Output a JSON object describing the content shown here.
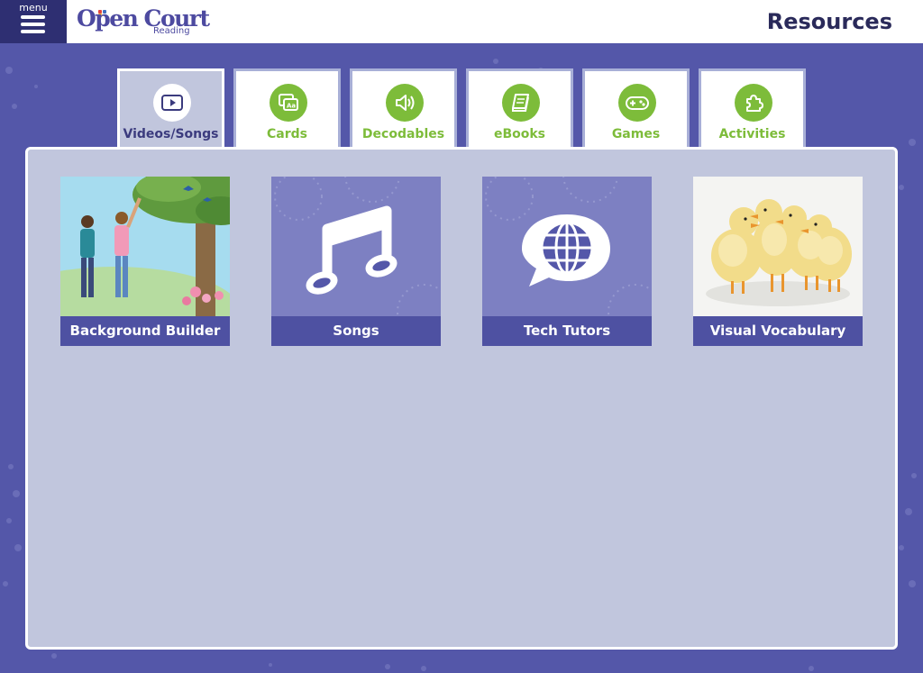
{
  "header": {
    "menu_label": "menu",
    "logo": {
      "text": "Open Court",
      "sub": "Reading"
    },
    "title": "Resources"
  },
  "tabs": [
    {
      "label": "Videos/Songs",
      "icon": "video-play-icon",
      "active": true
    },
    {
      "label": "Cards",
      "icon": "cards-icon",
      "active": false
    },
    {
      "label": "Decodables",
      "icon": "speaker-icon",
      "active": false
    },
    {
      "label": "eBooks",
      "icon": "book-icon",
      "active": false
    },
    {
      "label": "Games",
      "icon": "gamepad-icon",
      "active": false
    },
    {
      "label": "Activities",
      "icon": "puzzle-icon",
      "active": false
    }
  ],
  "cards": [
    {
      "label": "Background Builder",
      "image": "children-under-tree-image"
    },
    {
      "label": "Songs",
      "image": "music-note-icon"
    },
    {
      "label": "Tech Tutors",
      "image": "globe-speech-bubble-icon"
    },
    {
      "label": "Visual Vocabulary",
      "image": "ducklings-image"
    }
  ],
  "colors": {
    "background": "#5457a9",
    "menu": "#2e2f72",
    "tab_green": "#7dbc3a",
    "panel": "#c1c6dd",
    "card_label": "#4e51a2"
  }
}
